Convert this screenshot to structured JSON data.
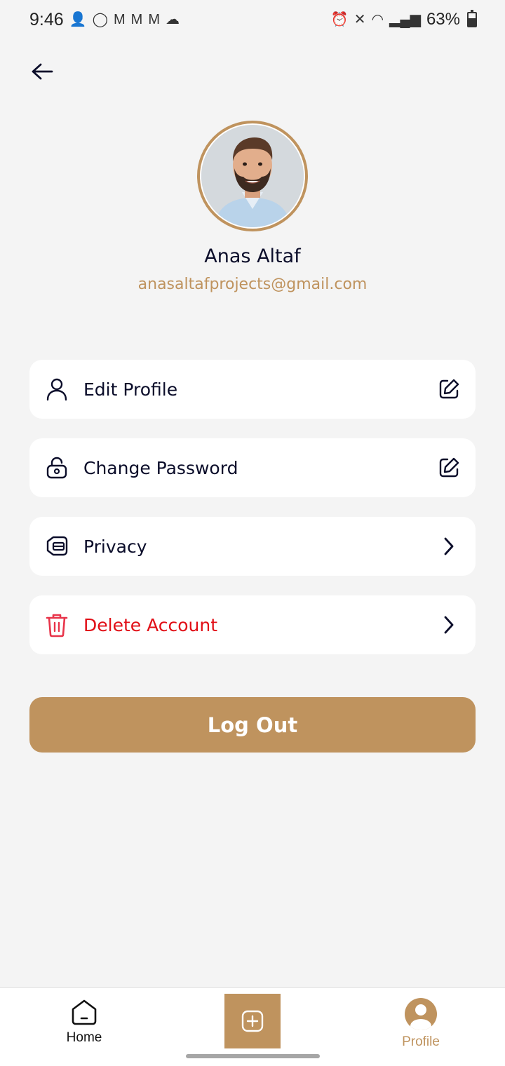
{
  "status_bar": {
    "time": "9:46",
    "battery": "63%"
  },
  "header": {
    "back_icon": "arrow-left-icon"
  },
  "profile": {
    "name": "Anas Altaf",
    "email": "anasaltafprojects@gmail.com"
  },
  "menu": [
    {
      "label": "Edit Profile",
      "icon": "user-icon",
      "action_icon": "edit-icon"
    },
    {
      "label": "Change Password",
      "icon": "lock-icon",
      "action_icon": "edit-icon"
    },
    {
      "label": "Privacy",
      "icon": "shield-icon",
      "action_icon": "chevron-right-icon"
    },
    {
      "label": "Delete Account",
      "icon": "trash-icon",
      "action_icon": "chevron-right-icon"
    }
  ],
  "logout_label": "Log Out",
  "bottom_nav": {
    "home_label": "Home",
    "profile_label": "Profile",
    "active": "Profile"
  },
  "colors": {
    "accent": "#bf935e",
    "danger": "#e10e16",
    "text": "#0b0d2a",
    "background": "#f4f4f4"
  }
}
